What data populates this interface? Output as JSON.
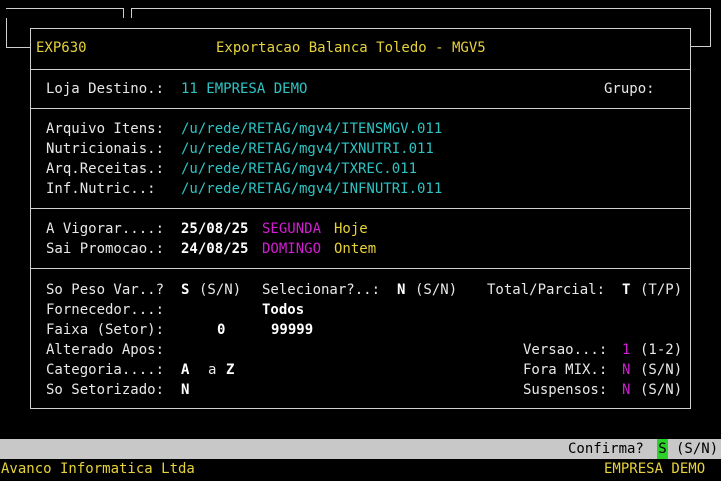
{
  "colors": {
    "cyan": "#2ec4c4",
    "yellow": "#e6d23a",
    "magenta": "#d21ed2",
    "status_bar": "#c8c8c8",
    "highlight": "#2bd02b"
  },
  "header": {
    "program": "EXP630",
    "title": "Exportacao Balanca Toledo - MGV5"
  },
  "loja": {
    "label": "Loja Destino.:",
    "value": "11 EMPRESA DEMO",
    "grupo_label": "Grupo:"
  },
  "files": [
    {
      "label": "Arquivo Itens:",
      "value": "/u/rede/RETAG/mgv4/ITENSMGV.011"
    },
    {
      "label": "Nutricionais.:",
      "value": "/u/rede/RETAG/mgv4/TXNUTRI.011"
    },
    {
      "label": "Arq.Receitas.:",
      "value": "/u/rede/RETAG/mgv4/TXREC.011"
    },
    {
      "label": "Inf.Nutric..:",
      "value": "/u/rede/RETAG/mgv4/INFNUTRI.011"
    }
  ],
  "dates": {
    "vigorar": {
      "label": "A Vigorar....:",
      "date": "25/08/25",
      "weekday": "SEGUNDA",
      "rel": "Hoje"
    },
    "promocao": {
      "label": "Sai Promocao.:",
      "date": "24/08/25",
      "weekday": "DOMINGO",
      "rel": "Ontem"
    }
  },
  "options": {
    "so_peso": {
      "label": "So Peso Var..?",
      "value": "S",
      "hint": "(S/N)"
    },
    "selecionar": {
      "label": "Selecionar?..:",
      "value": "N",
      "hint": "(S/N)"
    },
    "total_parcial": {
      "label": "Total/Parcial:",
      "value": "T",
      "hint": "(T/P)"
    },
    "fornecedor": {
      "label": "Fornecedor...:",
      "value": "Todos"
    },
    "faixa": {
      "label": "Faixa (Setor):",
      "from": "0",
      "to": "99999"
    },
    "alterado": {
      "label": "Alterado Apos:"
    },
    "versao": {
      "label": "Versao...:",
      "value": "1",
      "hint": "(1-2)"
    },
    "categoria": {
      "label": "Categoria....:",
      "from": "A",
      "sep": "a",
      "to": "Z"
    },
    "fora_mix": {
      "label": "Fora MIX.:",
      "value": "N",
      "hint": "(S/N)"
    },
    "setorizado": {
      "label": "So Setorizado:",
      "value": "N"
    },
    "suspensos": {
      "label": "Suspensos:",
      "value": "N",
      "hint": "(S/N)"
    }
  },
  "confirm": {
    "label": "Confirma?",
    "value": "S",
    "hint": "(S/N)"
  },
  "footer": {
    "company": "Avanco Informatica Ltda",
    "client": "EMPRESA DEMO"
  }
}
